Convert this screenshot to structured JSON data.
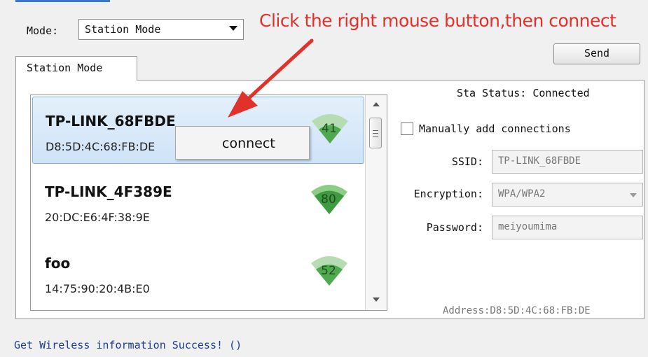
{
  "mode": {
    "label": "Mode:",
    "selected": "Station Mode"
  },
  "instruction": "Click the right mouse button,then connect",
  "send_label": "Send",
  "tab_label": "Station Mode",
  "networks": [
    {
      "ssid": "TP-LINK_68FBDE",
      "mac": "D8:5D:4C:68:FB:DE",
      "signal": "41"
    },
    {
      "ssid": "TP-LINK_4F389E",
      "mac": "20:DC:E6:4F:38:9E",
      "signal": "80"
    },
    {
      "ssid": "foo",
      "mac": "14:75:90:20:4B:E0",
      "signal": "52"
    }
  ],
  "context_menu": {
    "connect": "connect"
  },
  "sta_status": "Sta Status: Connected",
  "manual_label": "Manually add connections",
  "form": {
    "ssid_label": "SSID:",
    "ssid_value": "TP-LINK_68FBDE",
    "encryption_label": "Encryption:",
    "encryption_value": "WPA/WPA2",
    "password_label": "Password:",
    "password_value": "meiyoumima"
  },
  "address": "Address:D8:5D:4C:68:FB:DE",
  "status_message": "Get Wireless information Success! ()",
  "colors": {
    "annotation_red": "#e0312b",
    "signal_green": "#4faa4f",
    "selection_blue": "#cfe3f8"
  },
  "icons": {
    "signal": "wifi-signal-icon",
    "arrow": "annotation-arrow-icon",
    "dropdown": "chevron-down-icon"
  }
}
